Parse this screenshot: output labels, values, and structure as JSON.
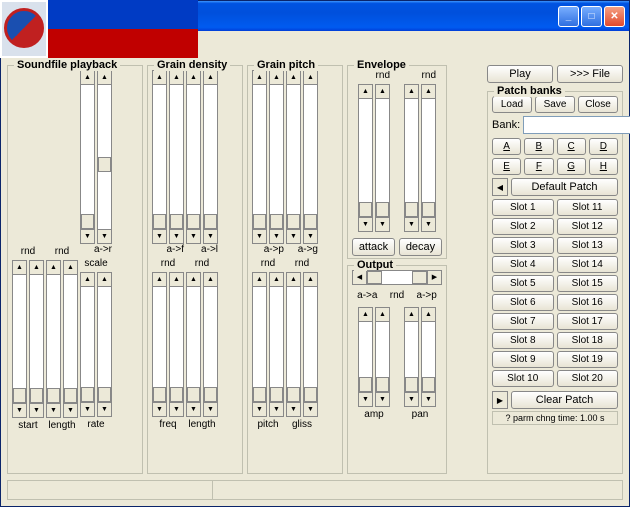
{
  "window": {
    "title": ""
  },
  "top": {
    "play": "Play",
    "file": ">>> File"
  },
  "groups": {
    "soundfile": "Soundfile playback",
    "density": "Grain density",
    "pitch": "Grain pitch",
    "envelope": "Envelope",
    "output": "Output",
    "patch": "Patch banks"
  },
  "soundfile": {
    "col1_mid": "rnd",
    "col1_lbl": "start",
    "col2_mid": "rnd",
    "col2_lbl": "length",
    "col3_top": "a->r",
    "col3_mid": "scale",
    "col3_lbl": "rate"
  },
  "density": {
    "col1_top": "a->f",
    "col1_mid": "rnd",
    "col1_lbl": "freq",
    "col2_top": "a->l",
    "col2_mid": "rnd",
    "col2_lbl": "length"
  },
  "pitch": {
    "col1_top": "a->p",
    "col1_mid": "rnd",
    "col1_lbl": "pitch",
    "col2_top": "a->g",
    "col2_mid": "rnd",
    "col2_lbl": "gliss"
  },
  "envelope": {
    "col1_top": "rnd",
    "col1_lbl": "attack",
    "col2_top": "rnd",
    "col2_lbl": "decay"
  },
  "output": {
    "col1_top": "a->a",
    "col1_mid": "rnd",
    "col1_lbl": "amp",
    "col2_top": "a->p",
    "col2_lbl": "pan"
  },
  "patch": {
    "load": "Load",
    "save": "Save",
    "close": "Close",
    "bank_label": "Bank:",
    "letters": [
      "A",
      "B",
      "C",
      "D",
      "E",
      "F",
      "G",
      "H"
    ],
    "default": "Default Patch",
    "slots": [
      "Slot 1",
      "Slot 2",
      "Slot 3",
      "Slot 4",
      "Slot 5",
      "Slot 6",
      "Slot 7",
      "Slot 8",
      "Slot 9",
      "Slot 10",
      "Slot 11",
      "Slot 12",
      "Slot 13",
      "Slot 14",
      "Slot 15",
      "Slot 16",
      "Slot 17",
      "Slot 18",
      "Slot 19",
      "Slot 20"
    ],
    "clear": "Clear Patch",
    "parm": "? parm chng time: 1.00 s"
  }
}
